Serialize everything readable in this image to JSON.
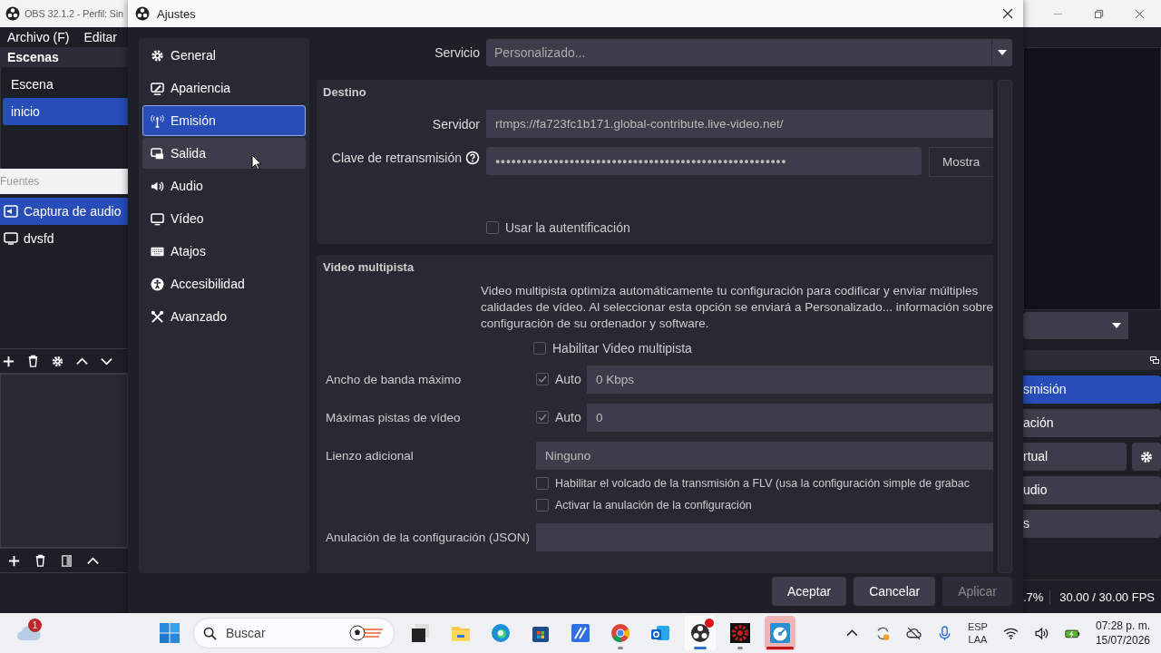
{
  "obs_window": {
    "title": "OBS 32.1.2 - Perfil: Sin",
    "menu": [
      "Archivo (F)",
      "Editar"
    ],
    "scenes": {
      "title": "Escenas",
      "items": [
        {
          "label": "Escena",
          "selected": false
        },
        {
          "label": "inicio",
          "selected": true
        }
      ]
    },
    "sources": {
      "title": "Fuentes",
      "items": [
        {
          "label": "Captura de audio",
          "kind": "audio",
          "selected": true
        },
        {
          "label": "dvsfd",
          "kind": "display",
          "selected": false
        }
      ]
    },
    "controls": [
      {
        "label": "smisión",
        "selected": true,
        "settings": false
      },
      {
        "label": "ación",
        "selected": false,
        "settings": false
      },
      {
        "label": "rtual",
        "selected": false,
        "settings": true
      },
      {
        "label": "udio",
        "selected": false,
        "settings": false
      },
      {
        "label": "s",
        "selected": false,
        "settings": false
      }
    ],
    "status_bar": {
      "cpu": ".7%",
      "fps": "30.00 / 30.00 FPS"
    }
  },
  "settings_dialog": {
    "title": "Ajustes",
    "sidebar": [
      {
        "label": "General",
        "kind": "gear",
        "selected": false,
        "hovered": false
      },
      {
        "label": "Apariencia",
        "kind": "appearance",
        "selected": false,
        "hovered": false
      },
      {
        "label": "Emisión",
        "kind": "antenna",
        "selected": true,
        "hovered": false
      },
      {
        "label": "Salida",
        "kind": "output",
        "selected": false,
        "hovered": true
      },
      {
        "label": "Audio",
        "kind": "speaker",
        "selected": false,
        "hovered": false
      },
      {
        "label": "Vídeo",
        "kind": "monitor",
        "selected": false,
        "hovered": false
      },
      {
        "label": "Atajos",
        "kind": "keyboard",
        "selected": false,
        "hovered": false
      },
      {
        "label": "Accesibilidad",
        "kind": "accessibility",
        "selected": false,
        "hovered": false
      },
      {
        "label": "Avanzado",
        "kind": "tools",
        "selected": false,
        "hovered": false
      }
    ],
    "service": {
      "label": "Servicio",
      "value": "Personalizado..."
    },
    "destination": {
      "title": "Destino",
      "server": {
        "label": "Servidor",
        "value": "rtmps://fa723fc1b171.global-contribute.live-video.net/"
      },
      "stream_key": {
        "label": "Clave de retransmisión",
        "value": "●●●●●●●●●●●●●●●●●●●●●●●●●●●●●●●●●●●●●●●●●●●●●●●●●●●●●●●",
        "button": "Mostra"
      },
      "auth": {
        "label": "Usar la autentificación",
        "checked": false
      }
    },
    "multitrack": {
      "title": "Video multipista",
      "description": [
        "Video multipista optimiza automáticamente tu configuración para codificar y enviar múltiples",
        "calidades de vídeo. Al seleccionar esta opción se enviará a Personalizado... información sobre",
        "configuración de su ordenador y software."
      ],
      "enable": {
        "label": "Habilitar Video multipista",
        "checked": false
      },
      "rows": [
        {
          "kind": "auto_field",
          "label": "Ancho de banda máximo",
          "auto_label": "Auto",
          "auto_checked": true,
          "value": "0 Kbps"
        },
        {
          "kind": "auto_field",
          "label": "Máximas pistas de vídeo",
          "auto_label": "Auto",
          "auto_checked": true,
          "value": "0"
        },
        {
          "kind": "select",
          "label": "Lienzo adicional",
          "value": "Ninguno"
        },
        {
          "kind": "checkbox",
          "label": "Habilitar el volcado de la transmisión a FLV (usa la configuración simple de grabac",
          "checked": false
        },
        {
          "kind": "checkbox",
          "label": "Activar la anulación de la configuración",
          "checked": false
        },
        {
          "kind": "field",
          "label": "Anulación de la configuración (JSON)"
        }
      ]
    },
    "buttons": [
      {
        "label": "Aceptar",
        "disabled": false
      },
      {
        "label": "Cancelar",
        "disabled": false
      },
      {
        "label": "Aplicar",
        "disabled": true
      }
    ]
  },
  "taskbar": {
    "weather_badge": "1",
    "search": {
      "placeholder": "Buscar"
    },
    "apps": [
      {
        "kind": "taskview",
        "running": false,
        "active": false,
        "attention": false,
        "badge": false
      },
      {
        "kind": "files",
        "running": false,
        "active": false,
        "attention": false,
        "badge": false
      },
      {
        "kind": "edge",
        "running": false,
        "active": false,
        "attention": false,
        "badge": false
      },
      {
        "kind": "store",
        "running": false,
        "active": false,
        "attention": false,
        "badge": false
      },
      {
        "kind": "blue",
        "running": false,
        "active": false,
        "attention": false,
        "badge": false
      },
      {
        "kind": "chrome",
        "running": true,
        "active": false,
        "attention": false,
        "badge": false
      },
      {
        "kind": "outlook",
        "running": false,
        "active": false,
        "attention": false,
        "badge": false
      },
      {
        "kind": "obs",
        "running": true,
        "active": true,
        "attention": false,
        "badge": true
      },
      {
        "kind": "gear",
        "running": true,
        "active": false,
        "attention": false,
        "badge": false
      },
      {
        "kind": "dial",
        "running": true,
        "active": false,
        "attention": true,
        "badge": false
      }
    ],
    "language": [
      "ESP",
      "LAA"
    ],
    "time": "07:28 p. m.",
    "date": "15/07/2026"
  }
}
